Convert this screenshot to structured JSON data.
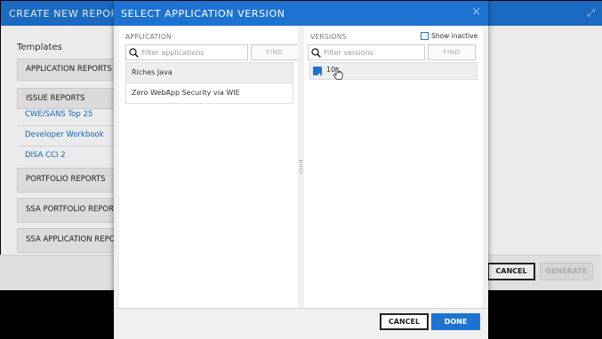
{
  "background_dialog": {
    "title": "CREATE NEW REPORT",
    "templates_label": "Templates",
    "groups": {
      "application_reports": "APPLICATION REPORTS",
      "issue_reports": "ISSUE REPORTS",
      "issue_items": [
        "CWE/SANS Top 25",
        "Developer Workbook",
        "DISA CCI 2"
      ],
      "portfolio_reports": "PORTFOLIO REPORTS",
      "ssa_portfolio_reports": "SSA PORTFOLIO REPORTS",
      "ssa_application_reports": "SSA APPLICATION REPORTS"
    },
    "cancel_label": "CANCEL",
    "generate_label": "GENERATE"
  },
  "modal": {
    "title": "SELECT APPLICATION VERSION",
    "close_glyph": "×",
    "application": {
      "label": "APPLICATION",
      "search_placeholder": "Filter applications",
      "find_label": "FIND",
      "items": [
        "Riches Java",
        "Zero WebApp Security via WIE"
      ]
    },
    "versions": {
      "label": "VERSIONS",
      "show_inactive_label": "Show inactive",
      "show_inactive_checked": false,
      "search_placeholder": "Filter versions",
      "find_label": "FIND",
      "items": [
        {
          "label": "10",
          "checked": true
        }
      ]
    },
    "cancel_label": "CANCEL",
    "done_label": "DONE"
  },
  "colors": {
    "accent": "#1e73d2",
    "link": "#1a6fd1"
  },
  "icons": {
    "search": "search-icon",
    "close": "close-icon",
    "checkbox": "checkbox-checked-icon",
    "cursor": "hand-pointer-icon"
  }
}
